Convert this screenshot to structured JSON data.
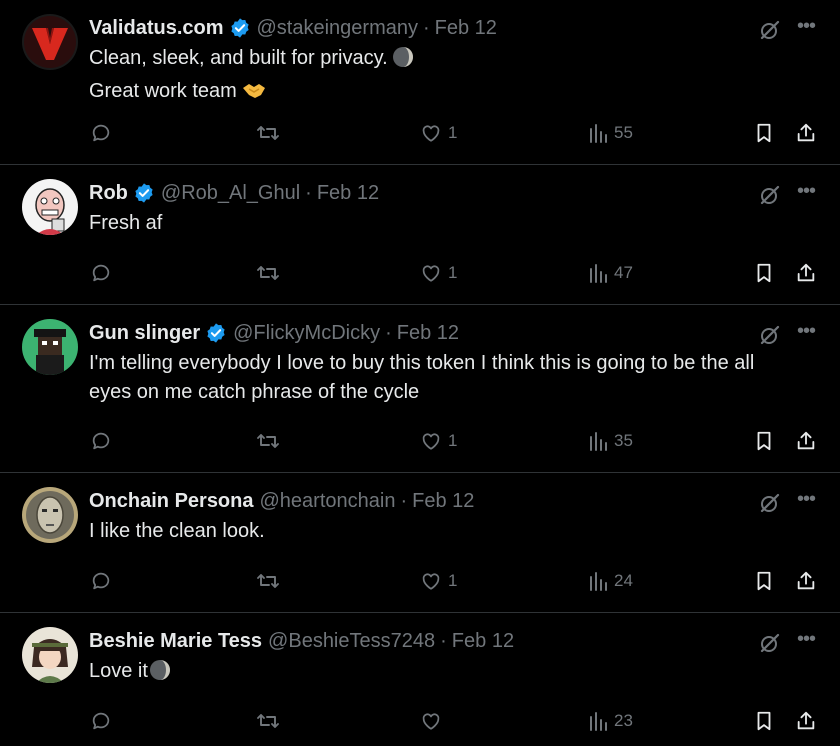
{
  "tweets": [
    {
      "avatar_icon": "red-v-logo-avatar",
      "name": "Validatus.com",
      "verified": true,
      "handle": "@stakeingermany",
      "date": "Feb 12",
      "lines": [
        "Clean, sleek, and built for privacy.",
        "Great work team"
      ],
      "line_emojis": [
        "moon-emoji",
        "handshake-emoji"
      ],
      "likes": "1",
      "views": "55"
    },
    {
      "avatar_icon": "cartoon-face-avatar",
      "name": "Rob",
      "verified": true,
      "handle": "@Rob_Al_Ghul",
      "date": "Feb 12",
      "lines": [
        "Fresh af"
      ],
      "likes": "1",
      "views": "47"
    },
    {
      "avatar_icon": "pixel-character-avatar",
      "name": "Gun slinger",
      "verified": true,
      "handle": "@FlickyMcDicky",
      "date": "Feb 12",
      "lines": [
        "I'm telling everybody I love to buy this token I think this is going to be the all",
        "eyes on me catch phrase of the cycle"
      ],
      "likes": "1",
      "views": "35"
    },
    {
      "avatar_icon": "gold-mask-avatar",
      "name": "Onchain Persona",
      "verified": false,
      "handle": "@heartonchain",
      "date": "Feb 12",
      "lines": [
        "I like the clean look."
      ],
      "likes": "1",
      "views": "24"
    },
    {
      "avatar_icon": "anime-girl-avatar",
      "name": "Beshie Marie Tess",
      "verified": false,
      "handle": "@BeshieTess7248",
      "date": "Feb 12",
      "lines": [
        "Love it"
      ],
      "line_emojis": [
        "moon-emoji"
      ],
      "likes": "",
      "views": "23"
    }
  ],
  "colors": {
    "background": "#000000",
    "text": "#e7e9ea",
    "muted": "#71767b",
    "divider": "#2f3336",
    "verified": "#1d9bf0"
  }
}
